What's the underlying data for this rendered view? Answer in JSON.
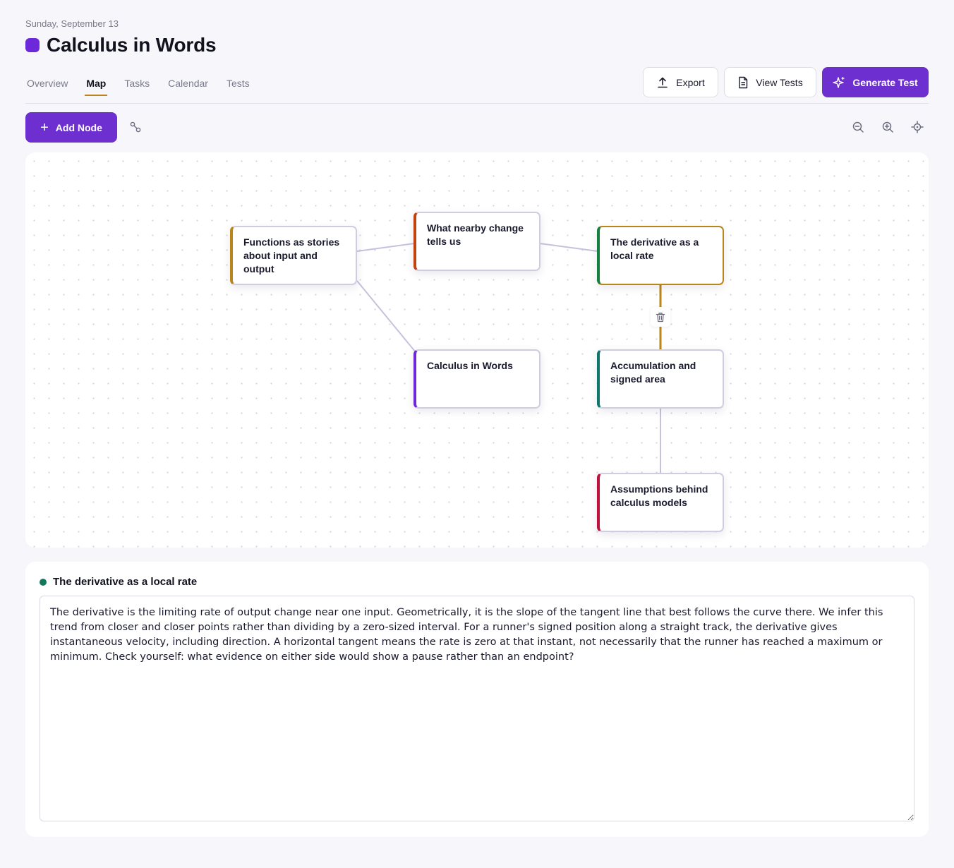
{
  "header": {
    "date": "Sunday, September 13",
    "title": "Calculus in Words",
    "accent_color": "#6d28d9"
  },
  "tabs": [
    {
      "label": "Overview",
      "active": false
    },
    {
      "label": "Map",
      "active": true
    },
    {
      "label": "Tasks",
      "active": false
    },
    {
      "label": "Calendar",
      "active": false
    },
    {
      "label": "Tests",
      "active": false
    }
  ],
  "actions": {
    "export_label": "Export",
    "view_tests_label": "View Tests",
    "generate_test_label": "Generate Test"
  },
  "toolbar": {
    "add_node_label": "Add Node",
    "icons": [
      "connect-icon",
      "zoom-out-icon",
      "zoom-in-icon",
      "recenter-icon"
    ]
  },
  "map": {
    "nodes": [
      {
        "id": "functions",
        "label": "Functions as stories about input and output",
        "color": "#b8861b"
      },
      {
        "id": "nearby",
        "label": "What nearby change tells us",
        "color": "#c2410c"
      },
      {
        "id": "derivative",
        "label": "The derivative as a local rate",
        "color": "#15803d",
        "selected": true
      },
      {
        "id": "calculus",
        "label": "Calculus in Words",
        "color": "#6d28d9"
      },
      {
        "id": "accumulation",
        "label": "Accumulation and signed area",
        "color": "#0f766e"
      },
      {
        "id": "assumptions",
        "label": "Assumptions behind calculus models",
        "color": "#be123c"
      }
    ],
    "edges": [
      [
        "functions",
        "nearby"
      ],
      [
        "nearby",
        "derivative"
      ],
      [
        "functions",
        "calculus"
      ],
      [
        "derivative",
        "accumulation"
      ],
      [
        "accumulation",
        "assumptions"
      ]
    ]
  },
  "detail": {
    "title": "The derivative as a local rate",
    "status_color": "#14785a",
    "text": "The derivative is the limiting rate of output change near one input. Geometrically, it is the slope of the tangent line that best follows the curve there. We infer this trend from closer and closer points rather than dividing by a zero-sized interval. For a runner's signed position along a straight track, the derivative gives instantaneous velocity, including direction. A horizontal tangent means the rate is zero at that instant, not necessarily that the runner has reached a maximum or minimum. Check yourself: what evidence on either side would show a pause rather than an endpoint?"
  }
}
